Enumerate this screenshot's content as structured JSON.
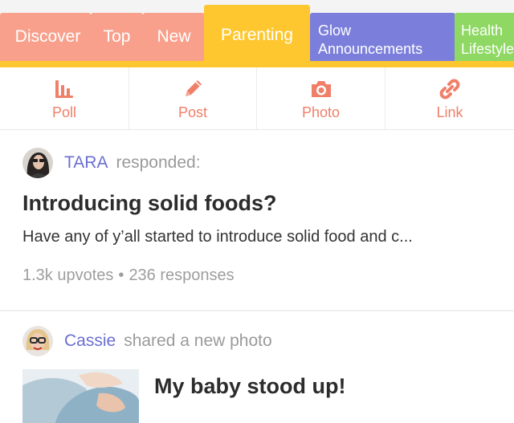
{
  "tabs": [
    {
      "label": "Discover"
    },
    {
      "label": "Top"
    },
    {
      "label": "New"
    },
    {
      "label": "Parenting",
      "active": true
    },
    {
      "label_line1": "Glow",
      "label_line2": "Announcements"
    },
    {
      "label_line1": "Health",
      "label_line2": "Lifestyle"
    }
  ],
  "actions": {
    "poll": "Poll",
    "post": "Post",
    "photo": "Photo",
    "link": "Link",
    "icons": [
      "bar-chart-icon",
      "pencil-icon",
      "camera-icon",
      "link-icon"
    ]
  },
  "feed": [
    {
      "author": "TARA",
      "action": "responded:",
      "title": "Introducing solid foods?",
      "excerpt": "Have any of y’all started to introduce solid food and c...",
      "upvotes": "1.3k upvotes",
      "separator": "•",
      "responses": "236 responses"
    },
    {
      "author": "Cassie",
      "action": "shared a new photo",
      "title": "My baby stood up!"
    }
  ],
  "colors": {
    "tab_salmon": "#f9a08c",
    "tab_active": "#ffc72f",
    "tab_glow": "#7b7fdb",
    "tab_health": "#8ed863",
    "action_text": "#f07f68",
    "author_name": "#6a6fd0",
    "meta_text": "#9a9a9a"
  }
}
